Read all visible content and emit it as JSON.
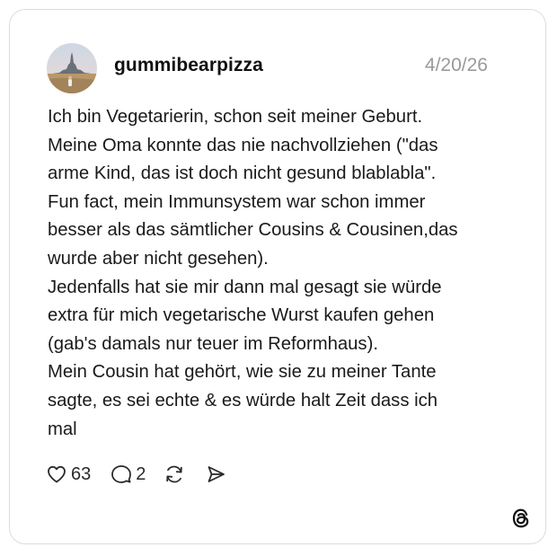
{
  "post": {
    "username": "gummibearpizza",
    "timestamp": "4/20/26",
    "avatar_icon": "avatar-photo-icon",
    "body_lines": [
      "Ich bin Vegetarierin, schon seit meiner Geburt.",
      "Meine Oma konnte das nie nachvollziehen (\"das",
      "arme Kind, das ist doch nicht gesund blablabla\".",
      "Fun fact, mein Immunsystem war schon immer",
      "besser als das sämtlicher Cousins & Cousinen,das",
      "wurde aber nicht gesehen).",
      "Jedenfalls hat sie mir dann mal gesagt sie würde",
      "extra für mich vegetarische Wurst kaufen gehen",
      "(gab's damals nur teuer im Reformhaus).",
      "Mein Cousin hat gehört, wie sie zu meiner Tante",
      "sagte, es sei echte & es würde halt Zeit dass ich",
      "mal"
    ]
  },
  "actions": {
    "like": {
      "icon": "heart-icon",
      "count": "63"
    },
    "reply": {
      "icon": "speech-bubble-icon",
      "count": "2"
    },
    "repost": {
      "icon": "repost-icon"
    },
    "share": {
      "icon": "send-icon"
    }
  },
  "branding": {
    "icon": "threads-logo-icon"
  },
  "colors": {
    "text": "#1a1a1a",
    "muted": "#9a9a9a",
    "border": "#dcdcdc",
    "background": "#ffffff"
  }
}
